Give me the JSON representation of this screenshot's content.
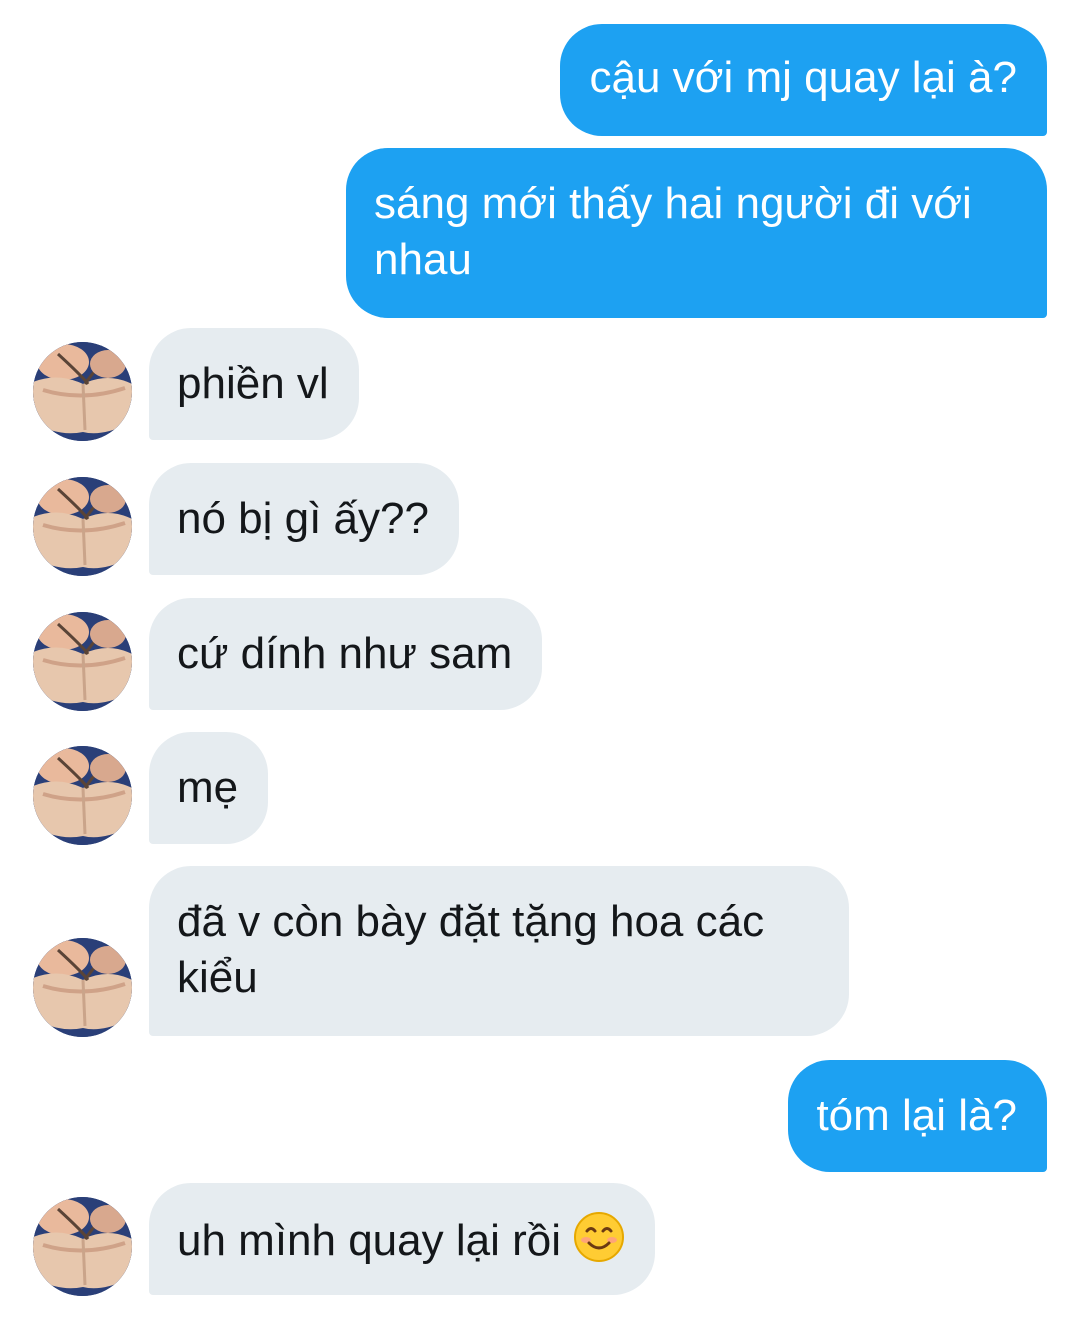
{
  "conversation": {
    "messages": [
      {
        "sender": "me",
        "text": "cậu với mj quay lại à?"
      },
      {
        "sender": "me",
        "text": "sáng mới thấy hai người đi với nhau"
      },
      {
        "sender": "them",
        "text": "phiền vl"
      },
      {
        "sender": "them",
        "text": "nó bị gì ấy??"
      },
      {
        "sender": "them",
        "text": "cứ dính như sam"
      },
      {
        "sender": "them",
        "text": "mẹ"
      },
      {
        "sender": "them",
        "text": "đã v còn bày đặt tặng hoa các kiểu"
      },
      {
        "sender": "me",
        "text": "tóm lại là?"
      },
      {
        "sender": "them",
        "text": "uh mình quay lại rồi",
        "emoji": "smiling-face-emoji"
      }
    ]
  },
  "colors": {
    "outgoing_bubble": "#1da1f2",
    "incoming_bubble": "#e6ecf0",
    "outgoing_text": "#ffffff",
    "incoming_text": "#14171a"
  }
}
